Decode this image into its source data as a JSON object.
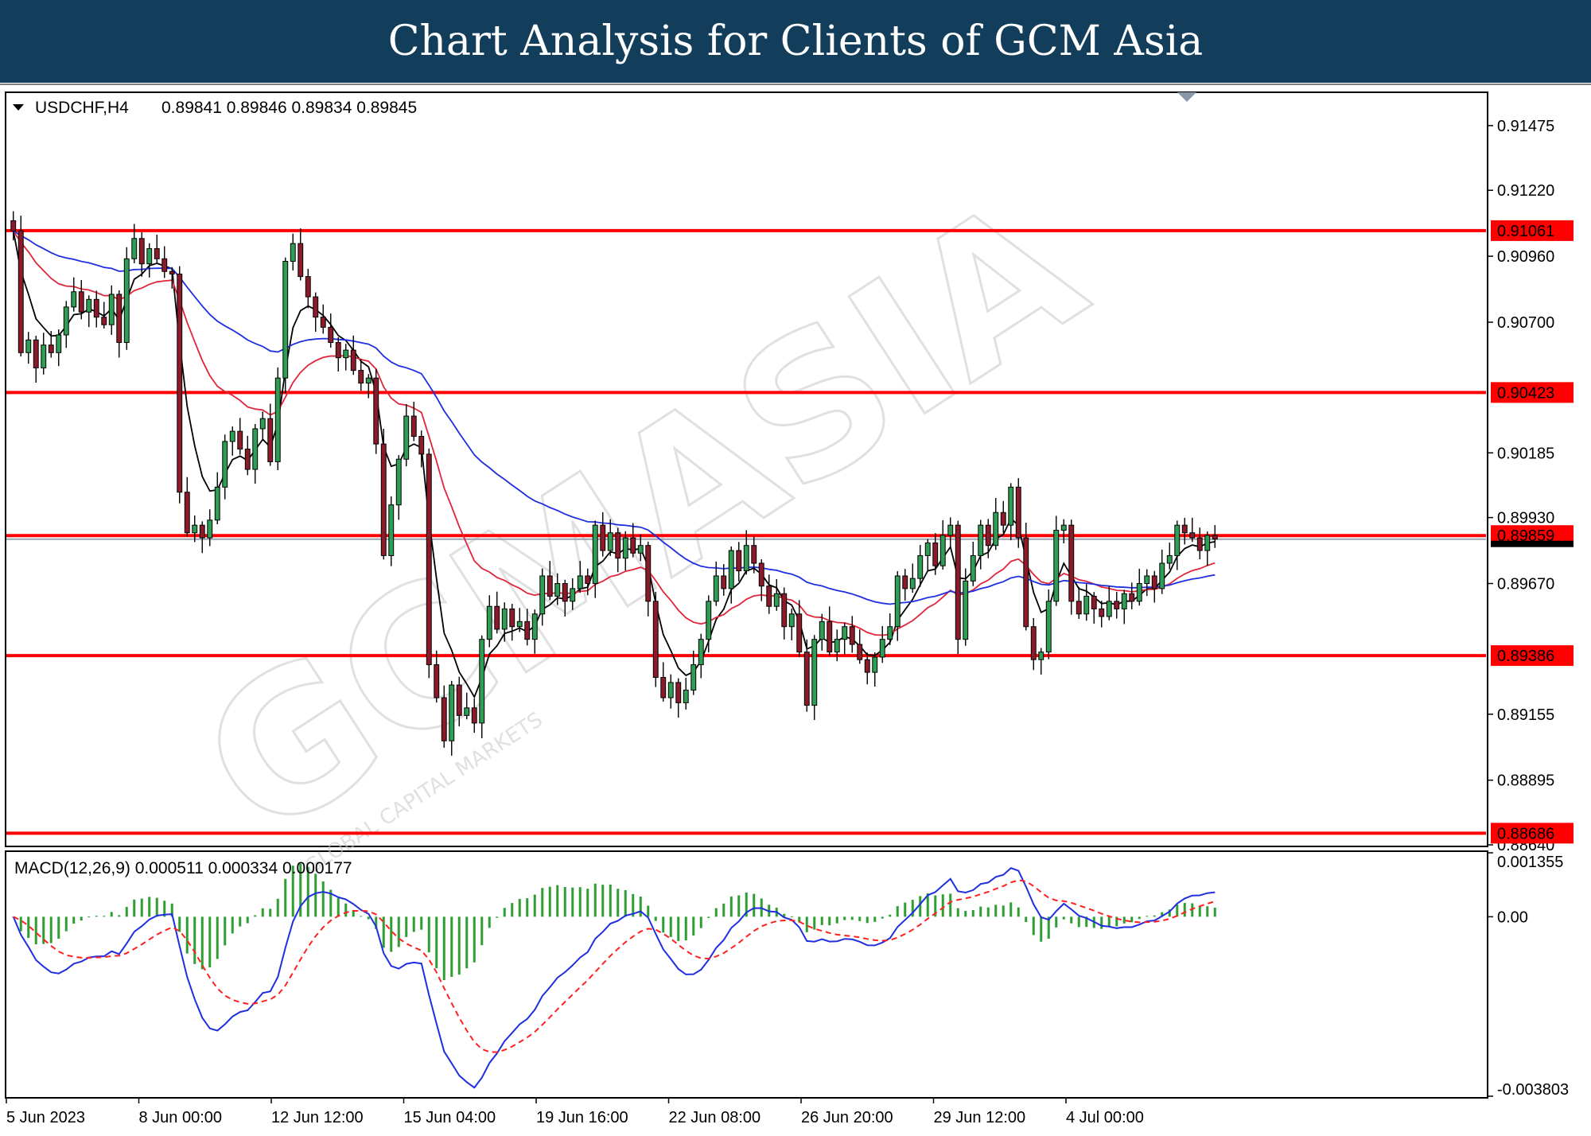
{
  "header": {
    "title": "Chart Analysis for Clients of GCM Asia"
  },
  "colors": {
    "banner": "#123e5c",
    "bull": "#2e9e55",
    "bear": "#8b1a2a",
    "level_line": "#ff0000",
    "ema_fast": "#000000",
    "ema_mid": "#e0263a",
    "ema_slow": "#1f2fe0",
    "macd_line": "#1f2fe0",
    "signal_line": "#ff2020",
    "histogram": "#2e9e33"
  },
  "watermark": {
    "brand": "GCMASIA",
    "tagline": "GLOBAL CAPITAL MARKETS"
  },
  "chart_data": [
    {
      "type": "candlestick",
      "info": {
        "toggle_icon": "triangle-down-icon",
        "symbol_label": "USDCHF,H4",
        "ohlc_values": "0.89841 0.89846 0.89834 0.89845"
      },
      "ylim": [
        0.8864,
        0.916
      ],
      "y_ticks": [
        "0.91475",
        "0.91220",
        "0.90960",
        "0.90700",
        "0.90185",
        "0.89930",
        "0.89670",
        "0.89155",
        "0.88895",
        "0.88640"
      ],
      "x_ticks": [
        "5 Jun 2023",
        "8 Jun 00:00",
        "12 Jun 12:00",
        "15 Jun 04:00",
        "19 Jun 16:00",
        "22 Jun 08:00",
        "26 Jun 20:00",
        "29 Jun 12:00",
        "4 Jul 00:00"
      ],
      "levels": [
        "0.91061",
        "0.90423",
        "0.89859",
        "0.89386",
        "0.88686"
      ],
      "current_price": "0.89845",
      "series": [
        {
          "kind": "ohlc",
          "closes": [
            0.9106,
            0.9058,
            0.9063,
            0.9052,
            0.9061,
            0.9058,
            0.9065,
            0.9076,
            0.9082,
            0.9074,
            0.9079,
            0.9072,
            0.9069,
            0.9081,
            0.9062,
            0.9095,
            0.9103,
            0.9093,
            0.9099,
            0.9095,
            0.909,
            0.9089,
            0.9003,
            0.8987,
            0.899,
            0.8985,
            0.8992,
            0.9005,
            0.9023,
            0.9027,
            0.902,
            0.9012,
            0.9028,
            0.9032,
            0.9015,
            0.9048,
            0.9094,
            0.9101,
            0.9088,
            0.908,
            0.9072,
            0.9068,
            0.9062,
            0.9056,
            0.9059,
            0.9051,
            0.9046,
            0.9048,
            0.9022,
            0.8978,
            0.8998,
            0.9016,
            0.9033,
            0.9025,
            0.9018,
            0.8935,
            0.8922,
            0.8905,
            0.8927,
            0.8915,
            0.8918,
            0.8912,
            0.8945,
            0.8958,
            0.8949,
            0.8957,
            0.895,
            0.8952,
            0.8945,
            0.8955,
            0.897,
            0.8962,
            0.8967,
            0.896,
            0.8965,
            0.897,
            0.8967,
            0.899,
            0.898,
            0.8987,
            0.8977,
            0.8985,
            0.8979,
            0.8982,
            0.896,
            0.893,
            0.8922,
            0.8928,
            0.892,
            0.8925,
            0.8935,
            0.8945,
            0.896,
            0.897,
            0.8965,
            0.898,
            0.8972,
            0.8982,
            0.8975,
            0.8966,
            0.8958,
            0.8963,
            0.895,
            0.8955,
            0.894,
            0.8919,
            0.8945,
            0.8952,
            0.894,
            0.8945,
            0.895,
            0.8943,
            0.8937,
            0.8932,
            0.8938,
            0.8945,
            0.895,
            0.897,
            0.8965,
            0.8969,
            0.8978,
            0.8983,
            0.8974,
            0.8986,
            0.899,
            0.8945,
            0.8968,
            0.8978,
            0.899,
            0.8982,
            0.8995,
            0.899,
            0.9005,
            0.8985,
            0.895,
            0.8937,
            0.894,
            0.896,
            0.8988,
            0.899,
            0.896,
            0.8955,
            0.8962,
            0.8957,
            0.8954,
            0.896,
            0.8957,
            0.8963,
            0.896,
            0.8967,
            0.897,
            0.8965,
            0.8975,
            0.8978,
            0.899,
            0.8987,
            0.8985,
            0.898,
            0.8986,
            0.89845
          ]
        },
        {
          "name": "",
          "kind": "ema",
          "period": 5
        },
        {
          "name": "",
          "kind": "ema",
          "period": 20
        },
        {
          "name": "",
          "kind": "ema",
          "period": 50
        }
      ]
    },
    {
      "type": "macd",
      "label": "MACD(12,26,9) 0.000511 0.000334 0.000177",
      "ylim": [
        -0.003803,
        0.001355
      ],
      "y_ticks": [
        "0.001355",
        "0.00",
        "-0.003803"
      ]
    }
  ]
}
